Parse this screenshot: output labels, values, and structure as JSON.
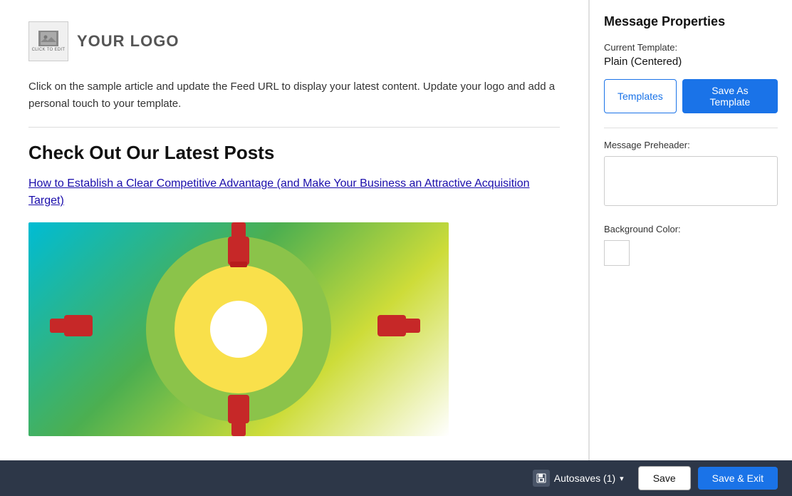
{
  "preview": {
    "logo_placeholder_text": "CLICK TO EDIT",
    "logo_text": "YOUR LOGO",
    "description": "Click on the sample article and update the Feed URL to display your latest content. Update your logo and add a personal touch to your template.",
    "section_heading": "Check Out Our Latest Posts",
    "article_link": "How to Establish a Clear Competitive Advantage (and Make Your Business an Attractive Acquisition Target)"
  },
  "properties_panel": {
    "title": "Message Properties",
    "current_template_label": "Current Template:",
    "current_template_value": "Plain (Centered)",
    "templates_button": "Templates",
    "save_as_template_button": "Save As Template",
    "preheader_label": "Message Preheader:",
    "preheader_value": "",
    "preheader_placeholder": "",
    "bg_color_label": "Background Color:"
  },
  "toolbar": {
    "autosaves_label": "Autosaves (1)",
    "save_label": "Save",
    "save_exit_label": "Save & Exit"
  },
  "icons": {
    "save_disk": "💾",
    "chevron": "▾",
    "image_placeholder": "🖼"
  }
}
